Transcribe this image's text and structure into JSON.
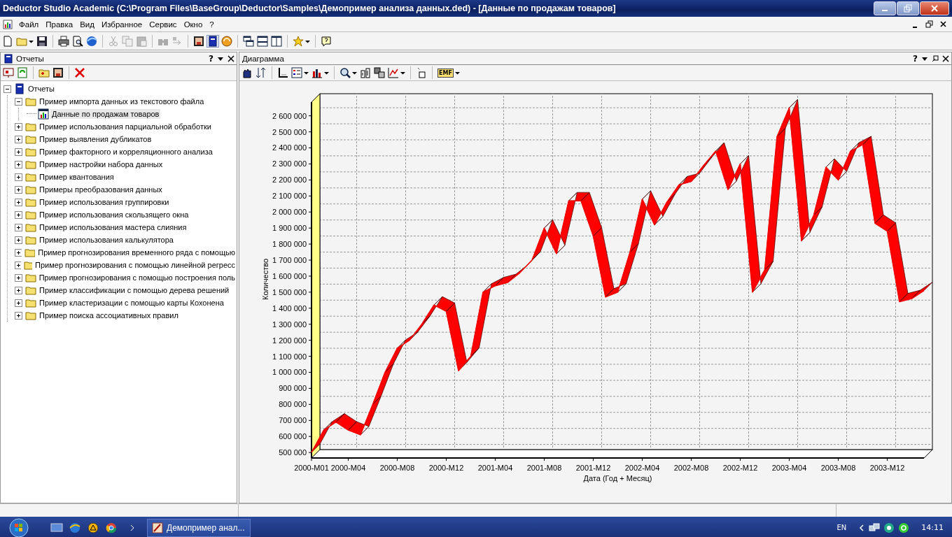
{
  "window": {
    "title": "Deductor Studio Academic (C:\\Program Files\\BaseGroup\\Deductor\\Samples\\Демопример анализа данных.ded) - [Данные по продажам товаров]"
  },
  "menu": [
    "Файл",
    "Правка",
    "Вид",
    "Избранное",
    "Сервис",
    "Окно",
    "?"
  ],
  "reports_panel": {
    "title": "Отчеты",
    "help": "?",
    "tree": [
      {
        "label": "Отчеты",
        "kind": "root",
        "expanded": true,
        "selected": false,
        "children": [
          {
            "label": "Пример импорта данных из текстового файла",
            "kind": "folder",
            "expanded": true,
            "selected": false,
            "children": [
              {
                "label": "Данные по продажам товаров",
                "kind": "report",
                "selected": true
              }
            ]
          },
          {
            "label": "Пример использования парциальной обработки",
            "kind": "folder",
            "expanded": false,
            "selected": false
          },
          {
            "label": "Пример выявления дубликатов",
            "kind": "folder",
            "expanded": false,
            "selected": false
          },
          {
            "label": "Пример факторного и корреляционного анализа",
            "kind": "folder",
            "expanded": false,
            "selected": false
          },
          {
            "label": "Пример настройки набора данных",
            "kind": "folder",
            "expanded": false,
            "selected": false
          },
          {
            "label": "Пример квантования",
            "kind": "folder",
            "expanded": false,
            "selected": false
          },
          {
            "label": "Примеры преобразования данных",
            "kind": "folder",
            "expanded": false,
            "selected": false
          },
          {
            "label": "Пример использования группировки",
            "kind": "folder",
            "expanded": false,
            "selected": false
          },
          {
            "label": "Пример использования скользящего окна",
            "kind": "folder",
            "expanded": false,
            "selected": false
          },
          {
            "label": "Пример использования  мастера слияния",
            "kind": "folder",
            "expanded": false,
            "selected": false
          },
          {
            "label": "Пример использования калькулятора",
            "kind": "folder",
            "expanded": false,
            "selected": false
          },
          {
            "label": "Пример прогнозирования временного ряда с помощью",
            "kind": "folder",
            "expanded": false,
            "selected": false
          },
          {
            "label": "Пример прогнозирования с помощью линейной регресс",
            "kind": "folder",
            "expanded": false,
            "selected": false
          },
          {
            "label": "Пример прогнозирования с помощью построения поль",
            "kind": "folder",
            "expanded": false,
            "selected": false
          },
          {
            "label": "Пример классификации с помощью дерева решений",
            "kind": "folder",
            "expanded": false,
            "selected": false
          },
          {
            "label": "Пример кластеризации с помощью карты Кохонена",
            "kind": "folder",
            "expanded": false,
            "selected": false
          },
          {
            "label": "Пример поиска ассоциативных правил",
            "kind": "folder",
            "expanded": false,
            "selected": false
          }
        ]
      }
    ]
  },
  "chart_panel": {
    "title": "Диаграмма",
    "help": "?",
    "export_format": "EMF",
    "chart_data": {
      "type": "line",
      "xlabel": "Дата (Год + Месяц)",
      "ylabel": "Количество",
      "categories": [
        "2000-M01",
        null,
        null,
        "2000-M04",
        null,
        null,
        null,
        "2000-M08",
        null,
        null,
        null,
        "2000-M12",
        null,
        null,
        null,
        "2001-M04",
        null,
        null,
        null,
        "2001-M08",
        null,
        null,
        null,
        "2001-M12",
        null,
        null,
        null,
        "2002-M04",
        null,
        null,
        null,
        "2002-M08",
        null,
        null,
        null,
        "2002-M12",
        null,
        null,
        null,
        "2003-M04",
        null,
        null,
        null,
        "2003-M08",
        null,
        null,
        null,
        "2003-M12",
        null,
        null,
        null
      ],
      "series": [
        {
          "color": "#ff0000",
          "values": [
            500000,
            640000,
            690000,
            640000,
            610000,
            800000,
            1000000,
            1150000,
            1200000,
            1300000,
            1420000,
            1380000,
            1010000,
            1100000,
            1500000,
            1540000,
            1560000,
            1620000,
            1700000,
            1900000,
            1740000,
            2070000,
            2070000,
            1850000,
            1470000,
            1500000,
            1750000,
            2080000,
            1920000,
            2060000,
            2170000,
            2190000,
            2290000,
            2380000,
            2140000,
            2300000,
            1500000,
            1640000,
            2470000,
            2650000,
            1820000,
            1980000,
            2280000,
            2200000,
            2380000,
            2420000,
            1930000,
            1880000,
            1440000,
            1460000,
            1510000
          ]
        }
      ],
      "ylim": [
        470000,
        2690000
      ],
      "yticks": [
        {
          "value": 500000,
          "label": "500 000"
        },
        {
          "value": 600000,
          "label": "600 000"
        },
        {
          "value": 700000,
          "label": "700 000"
        },
        {
          "value": 800000,
          "label": "800 000"
        },
        {
          "value": 900000,
          "label": "900 000"
        },
        {
          "value": 1000000,
          "label": "1 000 000"
        },
        {
          "value": 1100000,
          "label": "1 100 000"
        },
        {
          "value": 1200000,
          "label": "1 200 000"
        },
        {
          "value": 1300000,
          "label": "1 300 000"
        },
        {
          "value": 1400000,
          "label": "1 400 000"
        },
        {
          "value": 1500000,
          "label": "1 500 000"
        },
        {
          "value": 1600000,
          "label": "1 600 000"
        },
        {
          "value": 1700000,
          "label": "1 700 000"
        },
        {
          "value": 1800000,
          "label": "1 800 000"
        },
        {
          "value": 1900000,
          "label": "1 900 000"
        },
        {
          "value": 2000000,
          "label": "2 000 000"
        },
        {
          "value": 2100000,
          "label": "2 100 000"
        },
        {
          "value": 2200000,
          "label": "2 200 000"
        },
        {
          "value": 2300000,
          "label": "2 300 000"
        },
        {
          "value": 2400000,
          "label": "2 400 000"
        },
        {
          "value": 2500000,
          "label": "2 500 000"
        },
        {
          "value": 2600000,
          "label": "2 600 000"
        }
      ]
    }
  },
  "taskbar": {
    "task": "Демопример анал...",
    "language": "EN",
    "clock": "14:11"
  }
}
